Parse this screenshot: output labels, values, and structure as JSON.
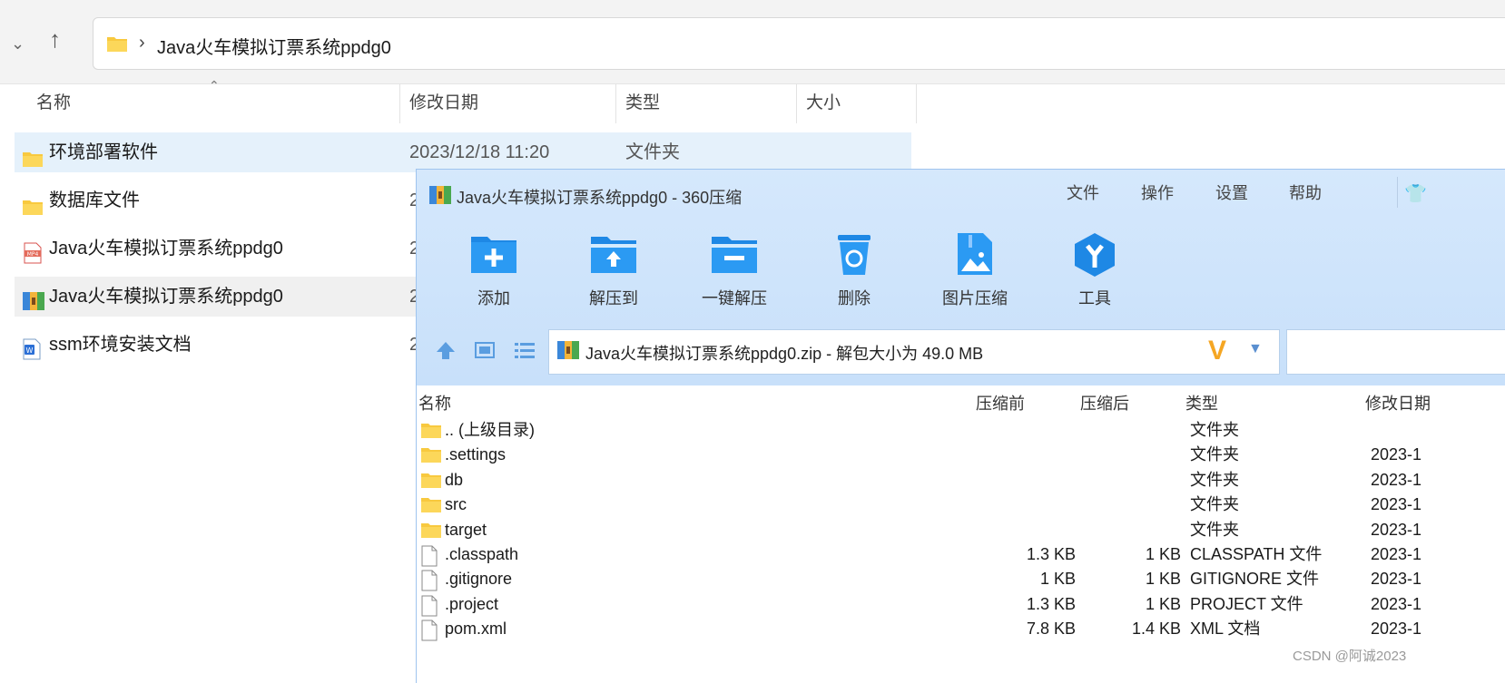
{
  "explorer": {
    "path": "Java火车模拟订票系统ppdg0",
    "columns": [
      "名称",
      "修改日期",
      "类型",
      "大小"
    ],
    "rows": [
      {
        "name": "环境部署软件",
        "date": "2023/12/18 11:20",
        "type": "文件夹",
        "icon": "folder-icon"
      },
      {
        "name": "数据库文件",
        "date": "2",
        "type": "",
        "icon": "folder-icon"
      },
      {
        "name": "Java火车模拟订票系统ppdg0",
        "date": "2",
        "type": "",
        "icon": "mp4-file-icon"
      },
      {
        "name": "Java火车模拟订票系统ppdg0",
        "date": "2",
        "type": "",
        "icon": "zip-archive-icon"
      },
      {
        "name": "ssm环境安装文档",
        "date": "2",
        "type": "",
        "icon": "word-doc-icon"
      }
    ]
  },
  "zip": {
    "title": "Java火车模拟订票系统ppdg0 - 360压缩",
    "menu": [
      "文件",
      "操作",
      "设置",
      "帮助"
    ],
    "tools": [
      "添加",
      "解压到",
      "一键解压",
      "删除",
      "图片压缩",
      "工具"
    ],
    "address": "Java火车模拟订票系统ppdg0.zip - 解包大小为 49.0 MB",
    "columns": {
      "name": "名称",
      "before": "压缩前",
      "after": "压缩后",
      "type": "类型",
      "date": "修改日期"
    },
    "rows": [
      {
        "name": ".. (上级目录)",
        "before": "",
        "after": "",
        "type": "文件夹",
        "date": "",
        "icon": "folder-icon"
      },
      {
        "name": ".settings",
        "before": "",
        "after": "",
        "type": "文件夹",
        "date": "2023-1",
        "icon": "folder-icon"
      },
      {
        "name": "db",
        "before": "",
        "after": "",
        "type": "文件夹",
        "date": "2023-1",
        "icon": "folder-icon"
      },
      {
        "name": "src",
        "before": "",
        "after": "",
        "type": "文件夹",
        "date": "2023-1",
        "icon": "folder-icon"
      },
      {
        "name": "target",
        "before": "",
        "after": "",
        "type": "文件夹",
        "date": "2023-1",
        "icon": "folder-icon"
      },
      {
        "name": ".classpath",
        "before": "1.3 KB",
        "after": "1 KB",
        "type": "CLASSPATH 文件",
        "date": "2023-1",
        "icon": "file-icon"
      },
      {
        "name": ".gitignore",
        "before": "1 KB",
        "after": "1 KB",
        "type": "GITIGNORE 文件",
        "date": "2023-1",
        "icon": "file-icon"
      },
      {
        "name": ".project",
        "before": "1.3 KB",
        "after": "1 KB",
        "type": "PROJECT 文件",
        "date": "2023-1",
        "icon": "file-icon"
      },
      {
        "name": "pom.xml",
        "before": "7.8 KB",
        "after": "1.4 KB",
        "type": "XML 文档",
        "date": "2023-1",
        "icon": "file-icon"
      }
    ]
  },
  "watermark": "CSDN @阿诚2023"
}
